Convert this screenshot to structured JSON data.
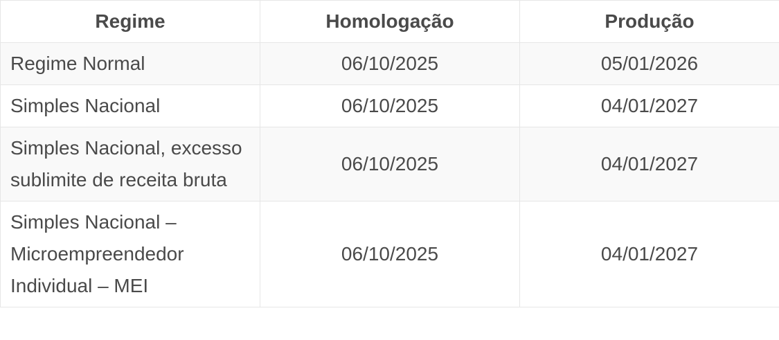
{
  "table": {
    "headers": [
      "Regime",
      "Homologação",
      "Produção"
    ],
    "rows": [
      {
        "regime": "Regime Normal",
        "homologacao": "06/10/2025",
        "producao": "05/01/2026"
      },
      {
        "regime": "Simples Nacional",
        "homologacao": "06/10/2025",
        "producao": "04/01/2027"
      },
      {
        "regime": "Simples Nacional, excesso sublimite de receita bruta",
        "homologacao": "06/10/2025",
        "producao": "04/01/2027"
      },
      {
        "regime": "Simples Nacional – Microempreendedor Individual – MEI",
        "homologacao": "06/10/2025",
        "producao": "04/01/2027"
      }
    ]
  }
}
